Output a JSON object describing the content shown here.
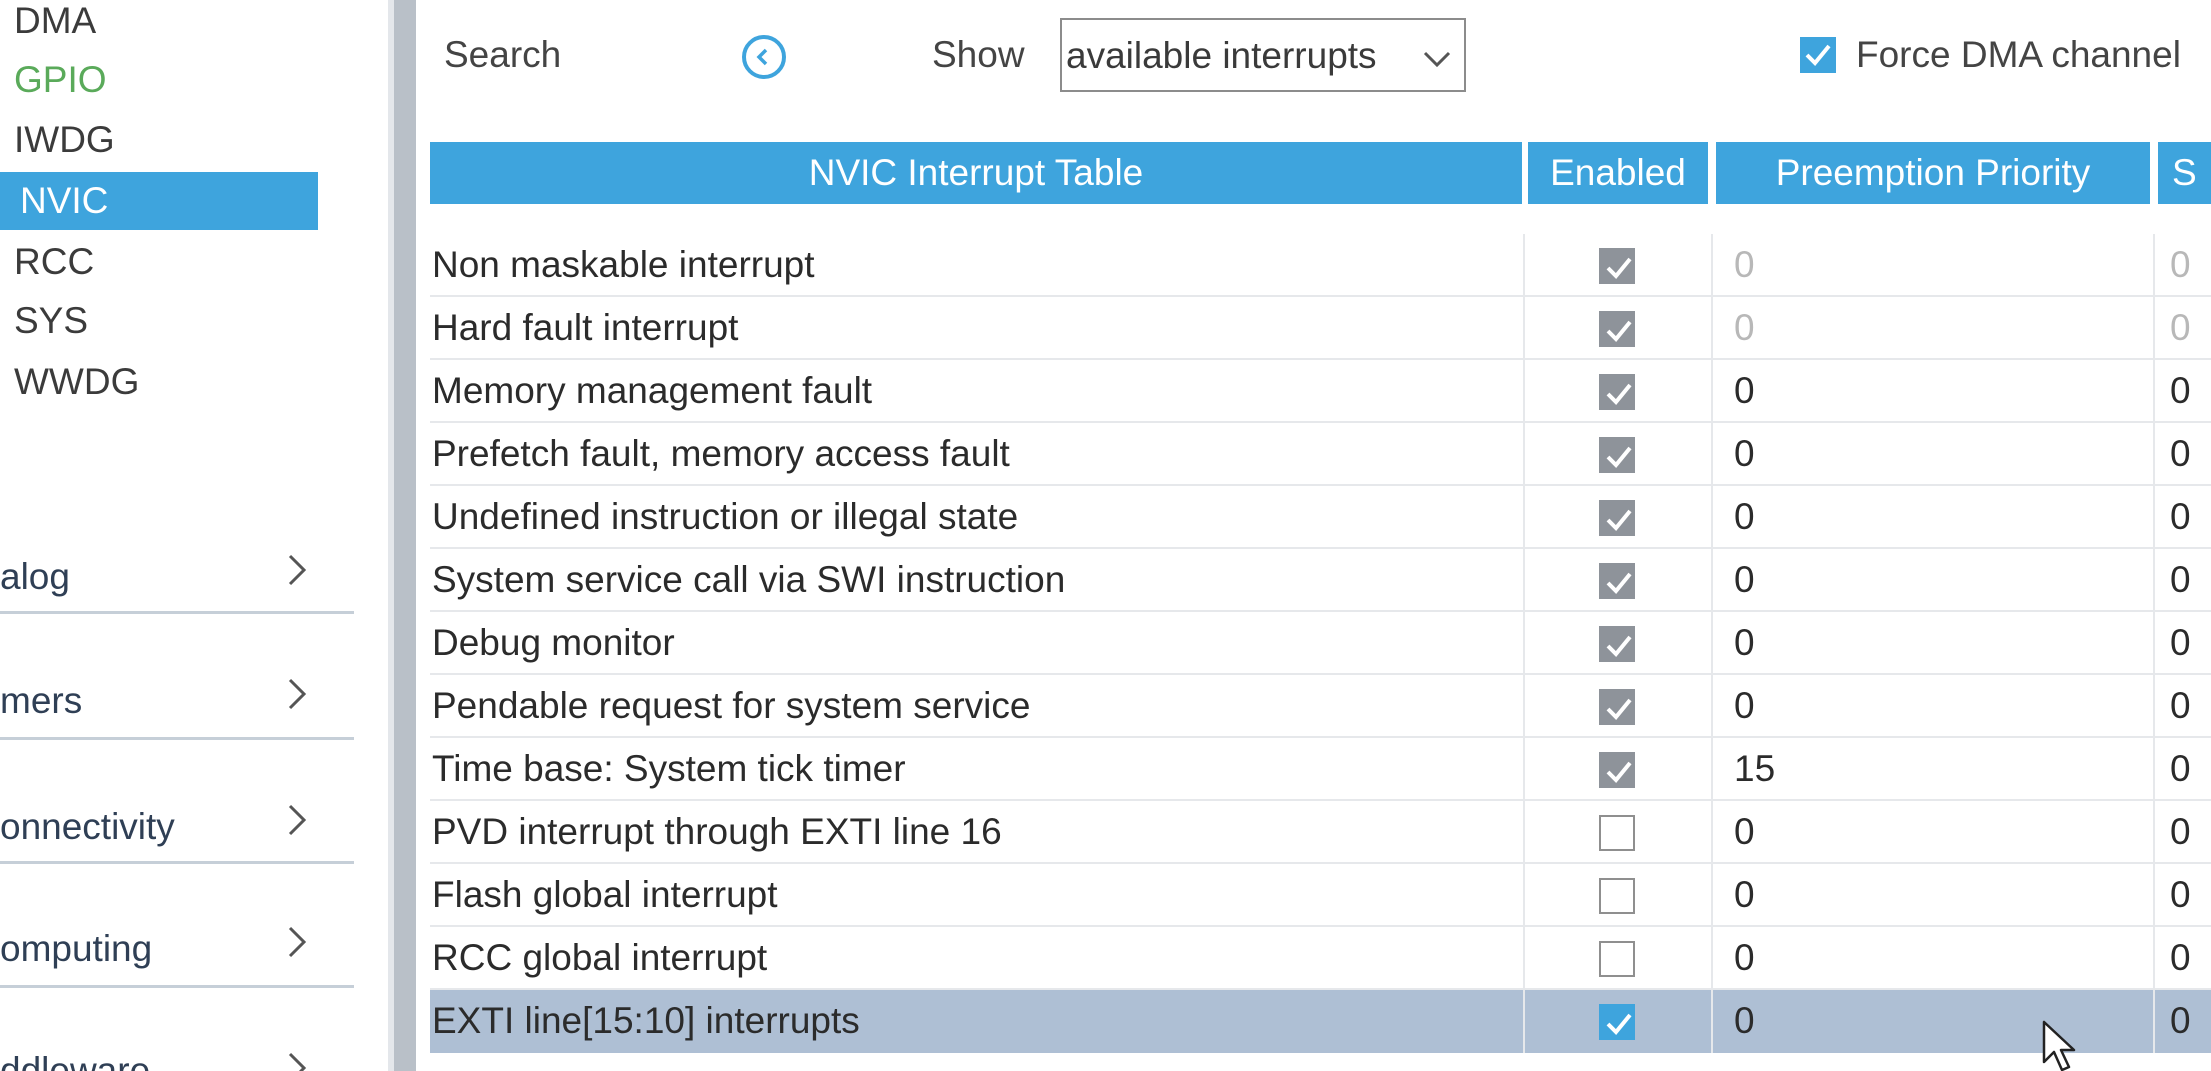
{
  "sidebar": {
    "peripherals": [
      "DMA",
      "GPIO",
      "IWDG",
      "NVIC",
      "RCC",
      "SYS",
      "WWDG"
    ],
    "selected": "NVIC",
    "categories": [
      "alog",
      "mers",
      "onnectivity",
      "omputing",
      "ddleware"
    ]
  },
  "toolbar": {
    "search_label": "Search",
    "show_label": "Show",
    "show_value": "available interrupts",
    "force_dma_label": "Force DMA channel",
    "force_dma_checked": true
  },
  "table": {
    "headers": {
      "name": "NVIC Interrupt Table",
      "enabled": "Enabled",
      "preemption": "Preemption Priority",
      "sub": "S"
    },
    "rows": [
      {
        "name": "Non maskable interrupt",
        "enabled": true,
        "preemption": "0",
        "sub": "0",
        "locked": true
      },
      {
        "name": "Hard fault interrupt",
        "enabled": true,
        "preemption": "0",
        "sub": "0",
        "locked": true
      },
      {
        "name": "Memory management fault",
        "enabled": true,
        "preemption": "0",
        "sub": "0"
      },
      {
        "name": "Prefetch fault, memory access fault",
        "enabled": true,
        "preemption": "0",
        "sub": "0"
      },
      {
        "name": "Undefined instruction or illegal state",
        "enabled": true,
        "preemption": "0",
        "sub": "0"
      },
      {
        "name": "System service call via SWI instruction",
        "enabled": true,
        "preemption": "0",
        "sub": "0"
      },
      {
        "name": "Debug monitor",
        "enabled": true,
        "preemption": "0",
        "sub": "0"
      },
      {
        "name": "Pendable request for system service",
        "enabled": true,
        "preemption": "0",
        "sub": "0"
      },
      {
        "name": "Time base: System tick timer",
        "enabled": true,
        "preemption": "15",
        "sub": "0"
      },
      {
        "name": "PVD interrupt through EXTI line 16",
        "enabled": false,
        "preemption": "0",
        "sub": "0"
      },
      {
        "name": "Flash global interrupt",
        "enabled": false,
        "preemption": "0",
        "sub": "0"
      },
      {
        "name": "RCC global interrupt",
        "enabled": false,
        "preemption": "0",
        "sub": "0"
      },
      {
        "name": "EXTI line[15:10] interrupts",
        "enabled": true,
        "preemption": "0",
        "sub": "0",
        "selected": true
      }
    ]
  },
  "colors": {
    "accent": "#3ea4dd",
    "selected_row": "#aebfd4",
    "gpio_text": "#5aaa5a",
    "checkbox_checked_grey": "#8e939a"
  }
}
